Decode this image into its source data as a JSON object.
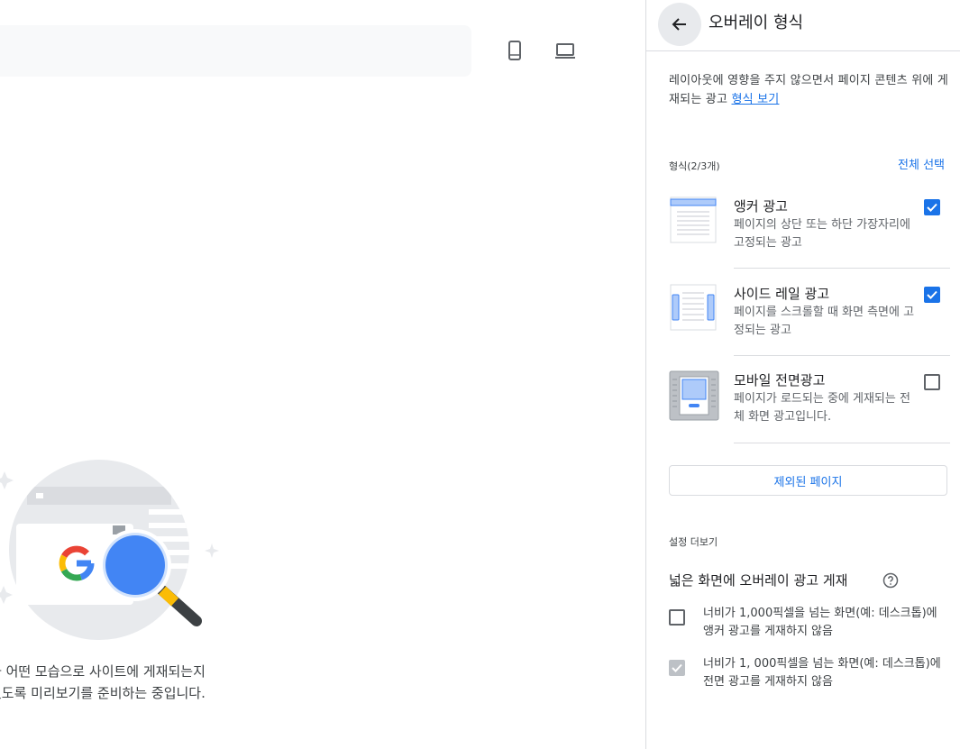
{
  "preview": {
    "mobile_icon": "smartphone-icon",
    "desktop_icon": "laptop-icon",
    "message_line1": "가 어떤 모습으로 사이트에 게재되는지",
    "message_line2": "있도록 미리보기를 준비하는 중입니다.",
    "illustration_logo": "G"
  },
  "panel": {
    "back_icon": "arrow-back-icon",
    "title": "오버레이 형식",
    "description": "레이아웃에 영향을 주지 않으면서 페이지 콘텐츠 위에 게재되는 광고",
    "description_link": "형식 보기",
    "formats_label": "형식(2/3개)",
    "select_all": "전체 선택",
    "formats": [
      {
        "title": "앵커 광고",
        "desc": "페이지의 상단 또는 하단 가장자리에 고정되는 광고",
        "checked": true,
        "icon": "anchor-ad-thumbnail"
      },
      {
        "title": "사이드 레일 광고",
        "desc": "페이지를 스크롤할 때 화면 측면에 고정되는 광고",
        "checked": true,
        "icon": "side-rail-ad-thumbnail"
      },
      {
        "title": "모바일 전면광고",
        "desc": "페이지가 로드되는 중에 게재되는 전체 화면 광고입니다.",
        "checked": false,
        "icon": "vignette-ad-thumbnail"
      }
    ],
    "excluded_pages": "제외된 페이지",
    "more_settings_label": "설정 더보기",
    "wide_screen_title": "넓은 화면에 오버레이 광고 게재",
    "help_icon": "help-circle-icon",
    "options": [
      {
        "line1": "너비가 1,000픽셀을 넘는 화면(예: 데스크톱)에",
        "line2": "앵커 광고를 게재하지 않음",
        "checked": false,
        "disabled": false
      },
      {
        "line1": "너비가 1, 000픽셀을 넘는 화면(예: 데스크톱)에",
        "line2": "전면 광고를 게재하지 않음",
        "checked": true,
        "disabled": true
      }
    ]
  },
  "colors": {
    "accent": "#1a73e8",
    "divider": "#dadce0",
    "muted_text": "#5f6368"
  }
}
